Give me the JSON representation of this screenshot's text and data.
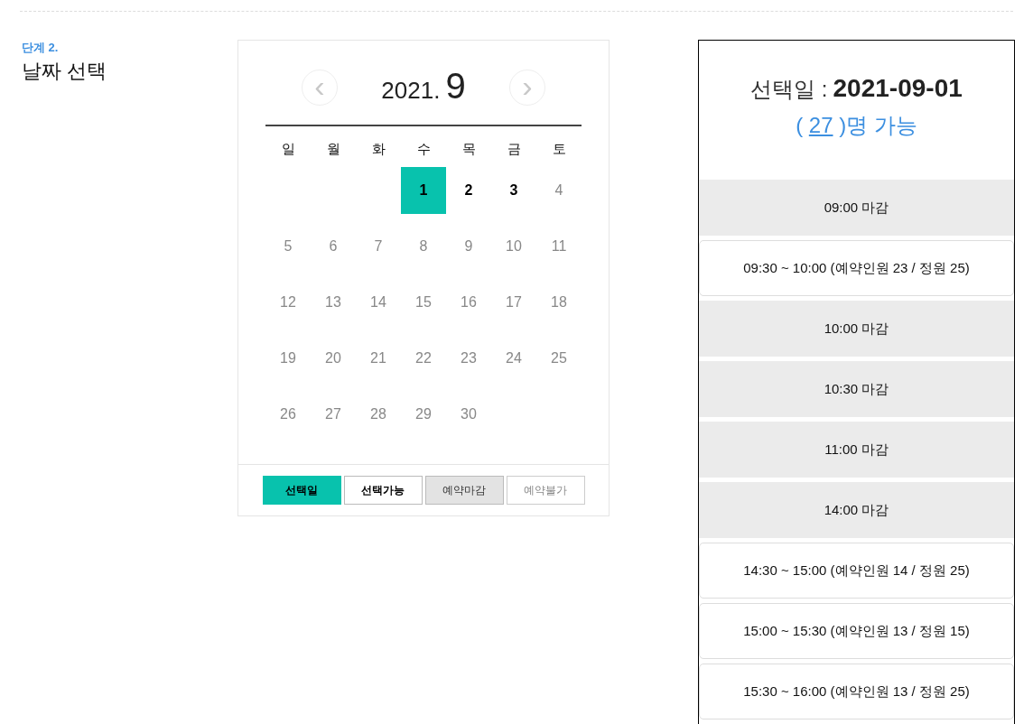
{
  "step": {
    "label": "단계 2.",
    "title": "날짜 선택"
  },
  "calendar": {
    "year": "2021.",
    "month": "9",
    "prev": "‹",
    "next": "›",
    "weekdays": [
      "일",
      "월",
      "화",
      "수",
      "목",
      "금",
      "토"
    ],
    "days": [
      {
        "kind": "blank"
      },
      {
        "kind": "blank"
      },
      {
        "kind": "blank"
      },
      {
        "kind": "day",
        "day": "1",
        "selected": true
      },
      {
        "kind": "day",
        "day": "2",
        "selected": false,
        "available": true
      },
      {
        "kind": "day",
        "day": "3",
        "selected": false,
        "available": true
      },
      {
        "kind": "day",
        "day": "4",
        "selected": false,
        "available": false
      },
      {
        "kind": "day",
        "day": "5",
        "selected": false,
        "available": false
      },
      {
        "kind": "day",
        "day": "6",
        "selected": false,
        "available": false
      },
      {
        "kind": "day",
        "day": "7",
        "selected": false,
        "available": false
      },
      {
        "kind": "day",
        "day": "8",
        "selected": false,
        "available": false
      },
      {
        "kind": "day",
        "day": "9",
        "selected": false,
        "available": false
      },
      {
        "kind": "day",
        "day": "10",
        "selected": false,
        "available": false
      },
      {
        "kind": "day",
        "day": "11",
        "selected": false,
        "available": false
      },
      {
        "kind": "day",
        "day": "12",
        "selected": false,
        "available": false
      },
      {
        "kind": "day",
        "day": "13",
        "selected": false,
        "available": false
      },
      {
        "kind": "day",
        "day": "14",
        "selected": false,
        "available": false
      },
      {
        "kind": "day",
        "day": "15",
        "selected": false,
        "available": false
      },
      {
        "kind": "day",
        "day": "16",
        "selected": false,
        "available": false
      },
      {
        "kind": "day",
        "day": "17",
        "selected": false,
        "available": false
      },
      {
        "kind": "day",
        "day": "18",
        "selected": false,
        "available": false
      },
      {
        "kind": "day",
        "day": "19",
        "selected": false,
        "available": false
      },
      {
        "kind": "day",
        "day": "20",
        "selected": false,
        "available": false
      },
      {
        "kind": "day",
        "day": "21",
        "selected": false,
        "available": false
      },
      {
        "kind": "day",
        "day": "22",
        "selected": false,
        "available": false
      },
      {
        "kind": "day",
        "day": "23",
        "selected": false,
        "available": false
      },
      {
        "kind": "day",
        "day": "24",
        "selected": false,
        "available": false
      },
      {
        "kind": "day",
        "day": "25",
        "selected": false,
        "available": false
      },
      {
        "kind": "day",
        "day": "26",
        "selected": false,
        "available": false
      },
      {
        "kind": "day",
        "day": "27",
        "selected": false,
        "available": false
      },
      {
        "kind": "day",
        "day": "28",
        "selected": false,
        "available": false
      },
      {
        "kind": "day",
        "day": "29",
        "selected": false,
        "available": false
      },
      {
        "kind": "day",
        "day": "30",
        "selected": false,
        "available": false
      }
    ],
    "legend": [
      {
        "label": "선택일",
        "kind": "selected"
      },
      {
        "label": "선택가능",
        "kind": "available"
      },
      {
        "label": "예약마감",
        "kind": "closed"
      },
      {
        "label": "예약불가",
        "kind": "unavailable"
      }
    ]
  },
  "summary": {
    "label": "선택일 :",
    "date": "2021-09-01",
    "open": "( ",
    "count": "27",
    "close": " )명 가능"
  },
  "slots": [
    {
      "text": "09:00 마감",
      "closed": true
    },
    {
      "text": "09:30 ~ 10:00 (예약인원 23 / 정원 25)",
      "closed": false
    },
    {
      "text": "10:00 마감",
      "closed": true
    },
    {
      "text": "10:30 마감",
      "closed": true
    },
    {
      "text": "11:00 마감",
      "closed": true
    },
    {
      "text": "14:00 마감",
      "closed": true
    },
    {
      "text": "14:30 ~ 15:00 (예약인원 14 / 정원 25)",
      "closed": false
    },
    {
      "text": "15:00 ~ 15:30 (예약인원 13 / 정원 15)",
      "closed": false
    },
    {
      "text": "15:30 ~ 16:00 (예약인원 13 / 정원 25)",
      "closed": false
    }
  ]
}
